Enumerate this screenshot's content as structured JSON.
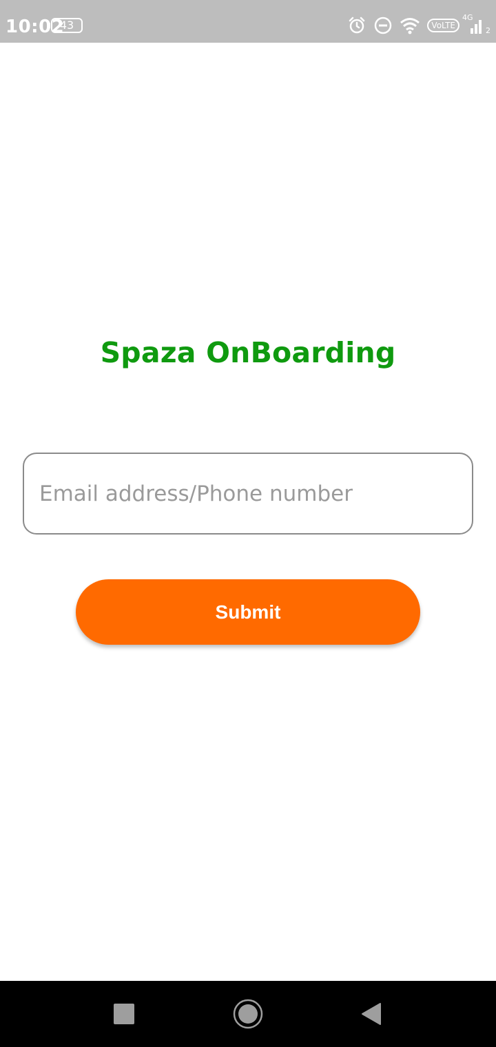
{
  "status_bar": {
    "time": "10:02",
    "battery": "43",
    "network_label": "VoLTE",
    "network_type": "4G",
    "sim_slot": "2",
    "icons": [
      "alarm-icon",
      "do-not-disturb-icon",
      "wifi-icon",
      "volte-icon",
      "signal-icon"
    ]
  },
  "page": {
    "title": "Spaza OnBoarding",
    "title_color": "#0f9a0f"
  },
  "form": {
    "identifier_placeholder": "Email address/Phone number",
    "identifier_value": "",
    "submit_label": "Submit",
    "submit_color": "#ff6a00"
  },
  "nav_bar": {
    "icons": [
      "recent-apps-icon",
      "home-icon",
      "back-icon"
    ]
  }
}
